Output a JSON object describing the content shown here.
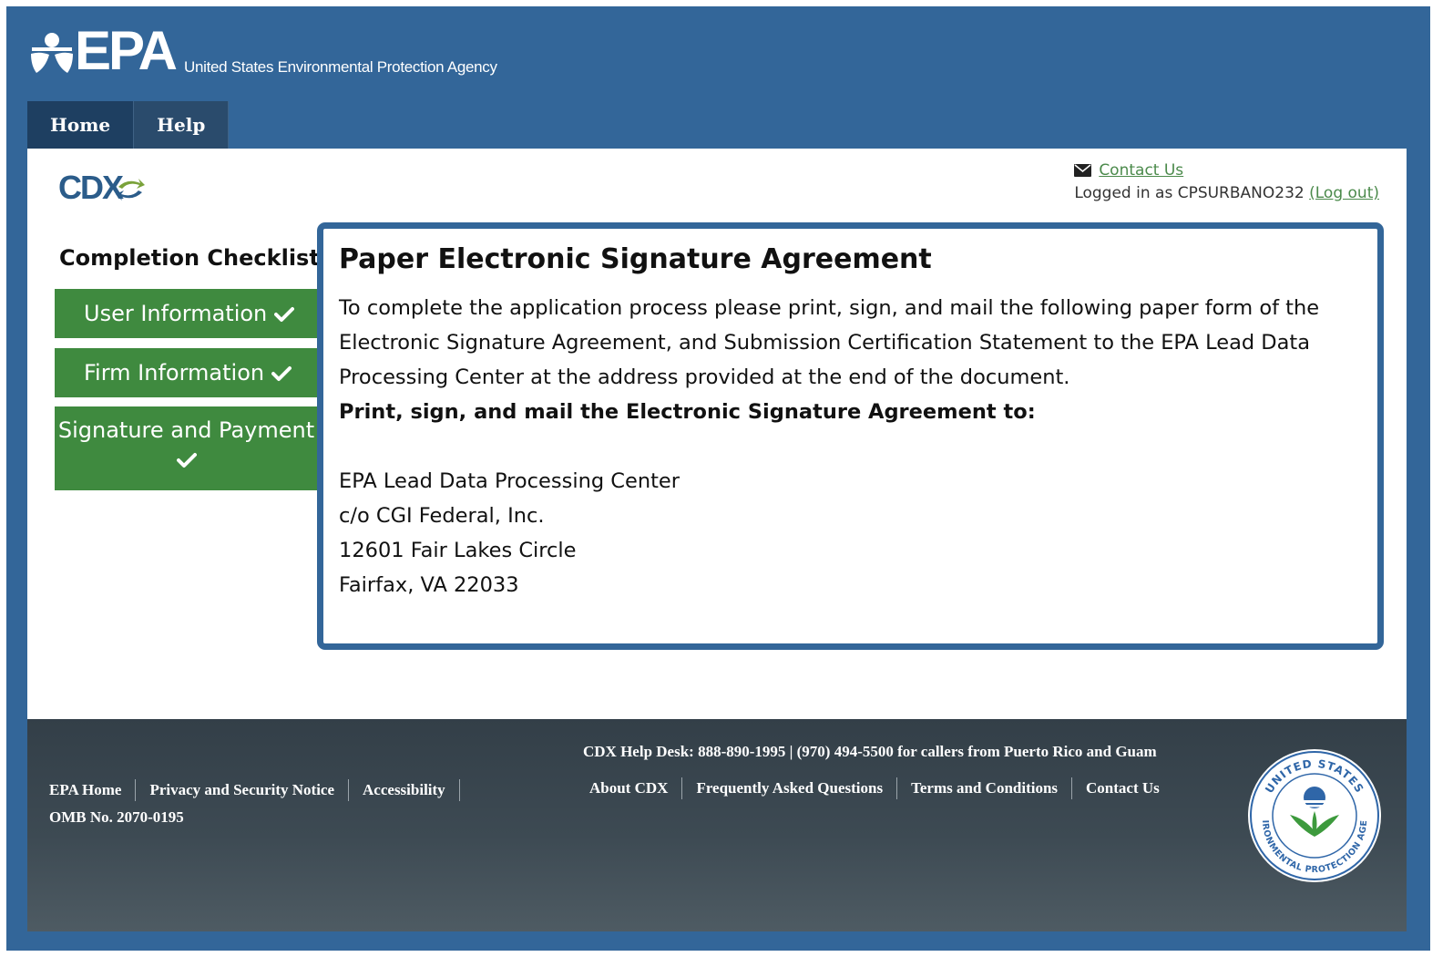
{
  "header": {
    "logo_text": "EPA",
    "agency_name": "United States Environmental Protection Agency",
    "nav": [
      "Home",
      "Help"
    ]
  },
  "cdx": {
    "logo_text": "CDX"
  },
  "account": {
    "contact_label": "Contact Us",
    "logged_in_prefix": "Logged in as CPSURBANO232",
    "logout_label": "(Log out)"
  },
  "checklist": {
    "title": "Completion Checklist",
    "items": [
      {
        "label": "User Information"
      },
      {
        "label": "Firm Information"
      },
      {
        "label": "Signature and Payment"
      }
    ]
  },
  "content": {
    "title": "Paper Electronic Signature Agreement",
    "intro": "To complete the application process please print, sign, and mail the following paper form of the Electronic Signature Agreement, and Submission Certification Statement to the EPA Lead Data Processing Center at the address provided at the end of the document.",
    "instruction": "Print, sign, and mail the Electronic Signature Agreement to:",
    "address": [
      "EPA Lead Data Processing Center",
      "c/o CGI Federal, Inc.",
      "12601 Fair Lakes Circle",
      "Fairfax, VA 22033"
    ]
  },
  "footer": {
    "left_links": [
      "EPA Home",
      "Privacy and Security Notice",
      "Accessibility"
    ],
    "omb": "OMB No. 2070-0195",
    "helpdesk": "CDX Help Desk: 888-890-1995 | (970) 494-5500 for callers from Puerto Rico and Guam",
    "center_links": [
      "About CDX",
      "Frequently Asked Questions",
      "Terms and Conditions",
      "Contact Us"
    ],
    "seal_text_top": "UNITED STATES",
    "seal_text_bottom": "ENVIRONMENTAL PROTECTION AGENCY"
  },
  "colors": {
    "frame": "#336699",
    "nav": "#1e3f61",
    "checklist_green": "#3f8a3f",
    "link_green": "#4b8a4b",
    "footer": "#3d4a53"
  },
  "icons": [
    "epa-logo-icon",
    "cdx-arrows-icon",
    "mail-icon",
    "checkmark-icon",
    "epa-seal-icon"
  ]
}
